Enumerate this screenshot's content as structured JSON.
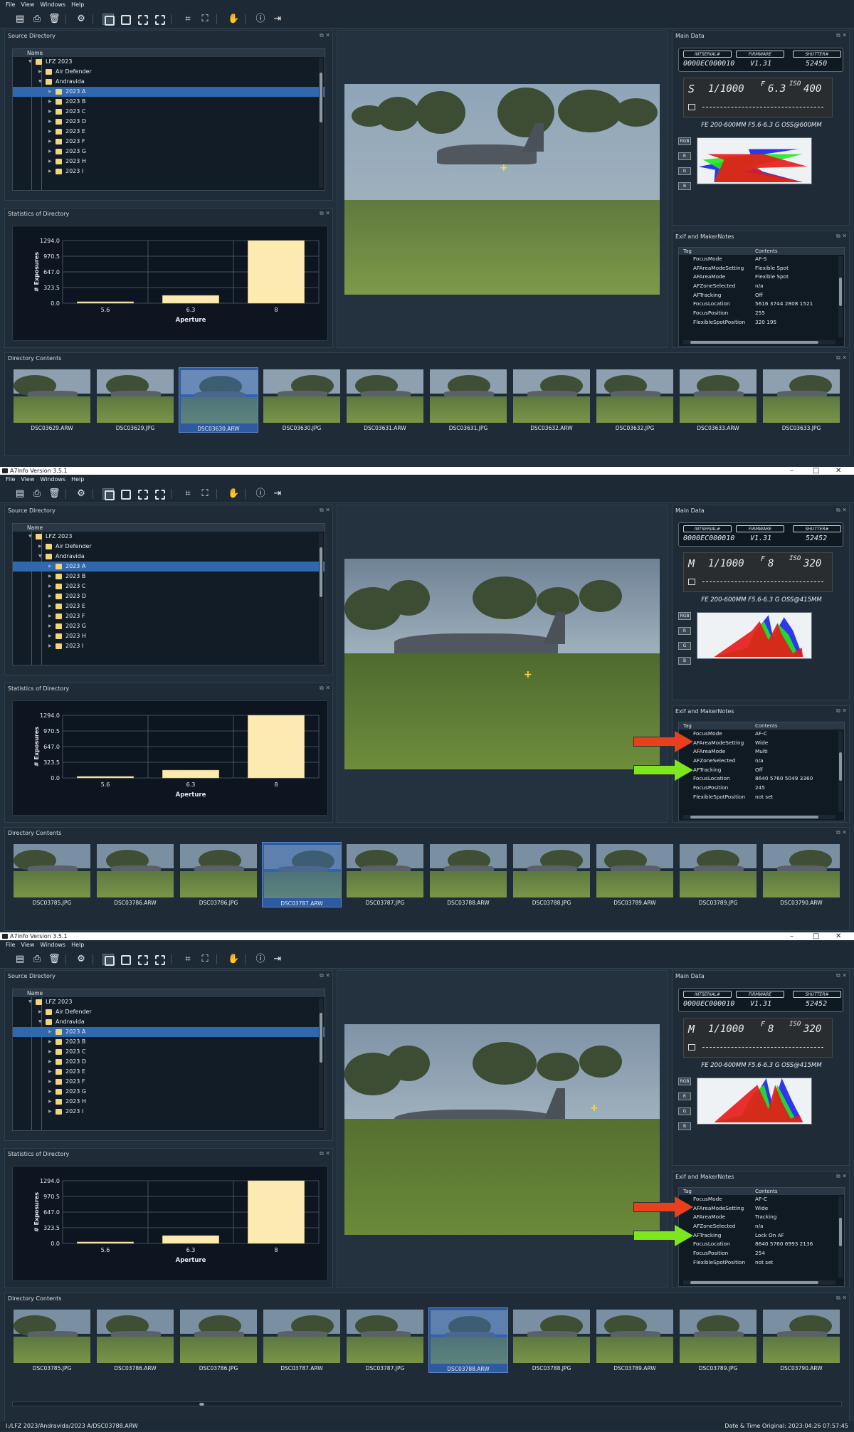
{
  "app": {
    "title": "A7Info Version 3.5.1",
    "menus": [
      "File",
      "View",
      "Windows",
      "Help"
    ],
    "window_controls": [
      "–",
      "□",
      "✕"
    ]
  },
  "panels": {
    "source": "Source Directory",
    "stats": "Statistics of Directory",
    "contents": "Directory Contents",
    "main": "Main Data",
    "exif": "Exif and MakerNotes"
  },
  "panel_buttons": "⧉ ✕",
  "tree": {
    "header": "Name",
    "items": [
      {
        "label": "LFZ 2023",
        "level": 0,
        "arrow": "▼"
      },
      {
        "label": "Air Defender",
        "level": 1,
        "arrow": "▶"
      },
      {
        "label": "Andravida",
        "level": 1,
        "arrow": "▼"
      },
      {
        "label": "2023 A",
        "level": 2,
        "arrow": "▶",
        "selected": true
      },
      {
        "label": "2023 B",
        "level": 2,
        "arrow": "▶"
      },
      {
        "label": "2023 C",
        "level": 2,
        "arrow": "▶"
      },
      {
        "label": "2023 D",
        "level": 2,
        "arrow": "▶"
      },
      {
        "label": "2023 E",
        "level": 2,
        "arrow": "▶"
      },
      {
        "label": "2023 F",
        "level": 2,
        "arrow": "▶"
      },
      {
        "label": "2023 G",
        "level": 2,
        "arrow": "▶"
      },
      {
        "label": "2023 H",
        "level": 2,
        "arrow": "▶"
      },
      {
        "label": "2023 I",
        "level": 2,
        "arrow": "▶"
      }
    ]
  },
  "chart_data": {
    "type": "bar",
    "categories": [
      "5.6",
      "6.3",
      "8"
    ],
    "values": [
      30,
      160,
      1294
    ],
    "yticks": [
      "1294.0",
      "970.5",
      "647.0",
      "323.5",
      "0.0"
    ],
    "ylim": [
      0,
      1294
    ],
    "xlabel": "Aperture",
    "ylabel": "# Exposures",
    "bar_color": "#fcebb0",
    "grid": true
  },
  "main_data_labels": {
    "serial": "INTSERIAL#",
    "firmware": "FIRMWARE",
    "shutter": "SHUTTER#",
    "rgb": "RGB",
    "r": "R",
    "g": "G",
    "b": "B",
    "exif_tag": "Tag",
    "exif_contents": "Contents"
  },
  "screens": [
    {
      "serial": "0000EC000010",
      "firmware": "V1.31",
      "shutter_count": "52450",
      "mode": "S",
      "speed": "1/1000",
      "fnum": "6.3",
      "iso": "400",
      "lens": "FE 200-600MM F5.6-6.3 G OSS@600MM",
      "exif": [
        [
          "FocusMode",
          "AF-S"
        ],
        [
          "AFAreaModeSetting",
          "Flexible Spot"
        ],
        [
          "AFAreaMode",
          "Flexible Spot"
        ],
        [
          "AFZoneSelected",
          "n/a"
        ],
        [
          "AFTracking",
          "Off"
        ],
        [
          "FocusLocation",
          "5616 3744 2808 1521"
        ],
        [
          "FocusPosition",
          "255"
        ],
        [
          "FlexibleSpotPosition",
          "320 195"
        ]
      ],
      "thumbs": [
        {
          "name": "DSC03629.ARW"
        },
        {
          "name": "DSC03629.JPG"
        },
        {
          "name": "DSC03630.ARW",
          "selected": true
        },
        {
          "name": "DSC03630.JPG"
        },
        {
          "name": "DSC03631.ARW"
        },
        {
          "name": "DSC03631.JPG"
        },
        {
          "name": "DSC03632.ARW"
        },
        {
          "name": "DSC03632.JPG"
        },
        {
          "name": "DSC03633.ARW"
        },
        {
          "name": "DSC03633.JPG"
        }
      ]
    },
    {
      "serial": "0000EC000010",
      "firmware": "V1.31",
      "shutter_count": "52452",
      "mode": "M",
      "speed": "1/1000",
      "fnum": "8",
      "iso": "320",
      "lens": "FE 200-600MM F5.6-6.3 G OSS@415MM",
      "exif": [
        [
          "FocusMode",
          "AF-C"
        ],
        [
          "AFAreaModeSetting",
          "Wide"
        ],
        [
          "AFAreaMode",
          "Multi"
        ],
        [
          "AFZoneSelected",
          "n/a"
        ],
        [
          "AFTracking",
          "Off"
        ],
        [
          "FocusLocation",
          "8640 5760 5049 3360"
        ],
        [
          "FocusPosition",
          "245"
        ],
        [
          "FlexibleSpotPosition",
          "not set"
        ]
      ],
      "thumbs": [
        {
          "name": "DSC03785.JPG"
        },
        {
          "name": "DSC03786.ARW"
        },
        {
          "name": "DSC03786.JPG"
        },
        {
          "name": "DSC03787.ARW",
          "selected": true
        },
        {
          "name": "DSC03787.JPG"
        },
        {
          "name": "DSC03788.ARW"
        },
        {
          "name": "DSC03788.JPG"
        },
        {
          "name": "DSC03789.ARW"
        },
        {
          "name": "DSC03789.JPG"
        },
        {
          "name": "DSC03790.ARW"
        }
      ]
    },
    {
      "serial": "0000EC000010",
      "firmware": "V1.31",
      "shutter_count": "52452",
      "mode": "M",
      "speed": "1/1000",
      "fnum": "8",
      "iso": "320",
      "lens": "FE 200-600MM F5.6-6.3 G OSS@415MM",
      "exif": [
        [
          "FocusMode",
          "AF-C"
        ],
        [
          "AFAreaModeSetting",
          "Wide"
        ],
        [
          "AFAreaMode",
          "Tracking"
        ],
        [
          "AFZoneSelected",
          "n/a"
        ],
        [
          "AFTracking",
          "Lock On AF"
        ],
        [
          "FocusLocation",
          "8640 5760 6993 2136"
        ],
        [
          "FocusPosition",
          "254"
        ],
        [
          "FlexibleSpotPosition",
          "not set"
        ]
      ],
      "thumbs": [
        {
          "name": "DSC03785.JPG"
        },
        {
          "name": "DSC03786.ARW"
        },
        {
          "name": "DSC03786.JPG"
        },
        {
          "name": "DSC03787.ARW"
        },
        {
          "name": "DSC03787.JPG"
        },
        {
          "name": "DSC03788.ARW",
          "selected": true
        },
        {
          "name": "DSC03788.JPG"
        },
        {
          "name": "DSC03789.ARW"
        },
        {
          "name": "DSC03789.JPG"
        },
        {
          "name": "DSC03790.ARW"
        }
      ]
    }
  ],
  "status": {
    "path": "I:/LFZ 2023/Andravida/2023 A/DSC03788.ARW",
    "date": "Date & Time Original: 2023:04:26 07:57:45"
  },
  "colors": {
    "bg": "#22303d",
    "panel": "#1f2c38",
    "selection": "#2f68ad",
    "arrow_red": "#e8401c",
    "arrow_green": "#7de61e",
    "hist_red": "#e81818",
    "hist_green": "#22e822",
    "hist_blue": "#1822e8"
  }
}
